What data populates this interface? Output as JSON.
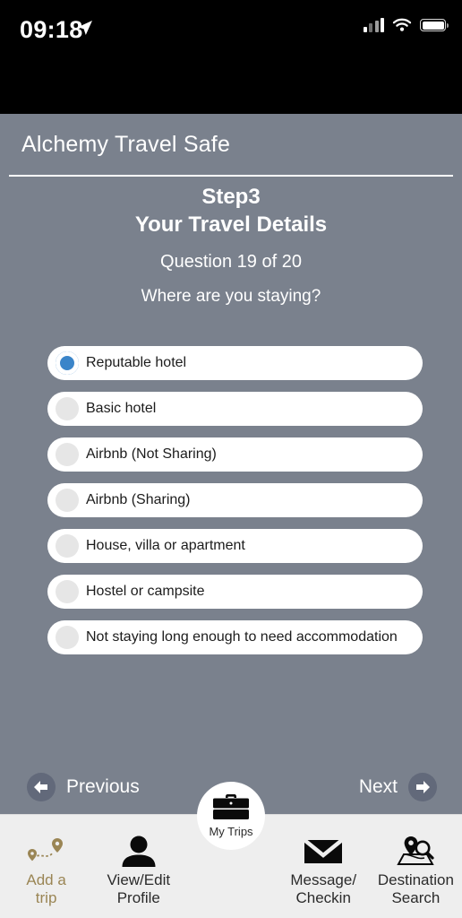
{
  "status_bar": {
    "time": "09:18",
    "location_icon": "location-arrow-icon",
    "signal_icon": "cellular-signal-icon",
    "wifi_icon": "wifi-icon",
    "battery_icon": "battery-icon"
  },
  "header": {
    "app_title": "Alchemy Travel Safe"
  },
  "question": {
    "step": "Step3",
    "section_title": "Your Travel Details",
    "progress": "Question 19 of 20",
    "prompt": "Where are you staying?"
  },
  "options": [
    {
      "label": "Reputable hotel",
      "selected": true
    },
    {
      "label": "Basic hotel",
      "selected": false
    },
    {
      "label": "Airbnb (Not Sharing)",
      "selected": false
    },
    {
      "label": "Airbnb (Sharing)",
      "selected": false
    },
    {
      "label": "House, villa or apartment",
      "selected": false
    },
    {
      "label": "Hostel or campsite",
      "selected": false
    },
    {
      "label": "Not staying long enough to need accommodation",
      "selected": false
    }
  ],
  "navigation": {
    "previous_label": "Previous",
    "next_label": "Next"
  },
  "tabbar": {
    "items": [
      {
        "label_line1": "Add a",
        "label_line2": "trip",
        "icon": "route-pins-icon",
        "active": true
      },
      {
        "label_line1": "View/Edit",
        "label_line2": "Profile",
        "icon": "person-icon",
        "active": false
      },
      {
        "label_line1": "Message/",
        "label_line2": "Checkin",
        "icon": "envelope-icon",
        "active": false
      },
      {
        "label_line1": "Destination",
        "label_line2": "Search",
        "icon": "map-search-icon",
        "active": false
      }
    ],
    "center_button": {
      "label": "My Trips",
      "icon": "briefcase-icon"
    }
  },
  "colors": {
    "background": "#7a818d",
    "accent_gold": "#9a8554",
    "radio_selected": "#3b85c9",
    "tabbar_background": "#eeeeee"
  }
}
